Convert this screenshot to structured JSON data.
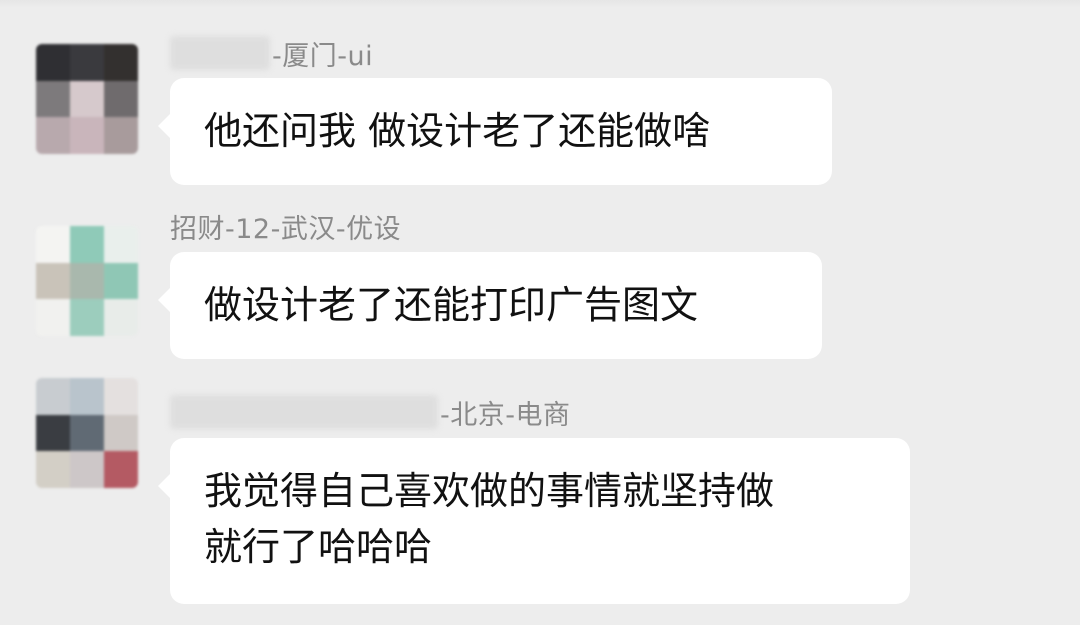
{
  "background_color": "#ededed",
  "bubble_color": "#ffffff",
  "messages": [
    {
      "sender_suffix": "-厦门-ui",
      "text": "他还问我 做设计老了还能做啥",
      "avatar_pixels": [
        "#2f2f33",
        "#3a3a3e",
        "#33302f",
        "#7d7a7c",
        "#d6c9cc",
        "#6f6b6d",
        "#b8a9ad",
        "#c9b5bb",
        "#a89b9c"
      ]
    },
    {
      "sender": "招财-12-武汉-优设",
      "text": "做设计老了还能打印广告图文",
      "avatar_pixels": [
        "#f4f4f2",
        "#8fcab8",
        "#e9efec",
        "#c9c3b9",
        "#a9b8ad",
        "#8fc7b5",
        "#f1f1ef",
        "#9ccdbd",
        "#e8ece9"
      ]
    },
    {
      "sender_suffix": "-北京-电商",
      "text_lines": [
        "我觉得自己喜欢做的事情就坚持做",
        "就行了哈哈哈"
      ],
      "avatar_pixels": [
        "#c8ccd0",
        "#b9c4cc",
        "#e4e0df",
        "#3a3d42",
        "#606a74",
        "#cfc9c6",
        "#d3cfc6",
        "#cdc7c8",
        "#b45a63"
      ]
    }
  ]
}
